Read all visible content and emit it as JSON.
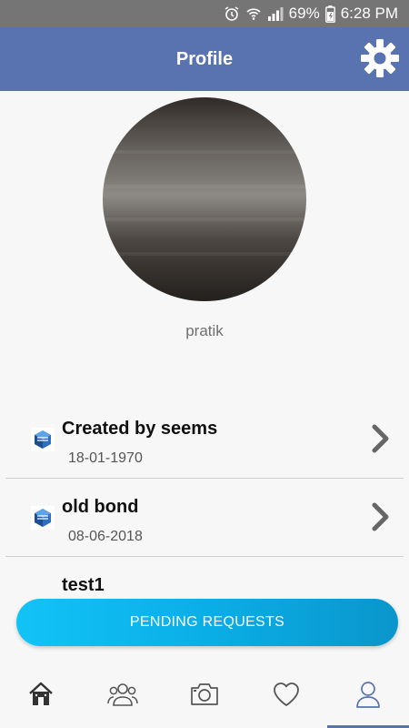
{
  "status_bar": {
    "battery": "69%",
    "time": "6:28 PM"
  },
  "header": {
    "title": "Profile"
  },
  "profile": {
    "username": "pratik"
  },
  "bonds": [
    {
      "name": "Created by seems",
      "date": "18-01-1970"
    },
    {
      "name": "old bond",
      "date": "08-06-2018"
    },
    {
      "name": "test1",
      "date": ""
    }
  ],
  "actions": {
    "pending_requests": "PENDING REQUESTS"
  },
  "bottom_nav": [
    {
      "icon": "home-icon",
      "active": false
    },
    {
      "icon": "group-icon",
      "active": false
    },
    {
      "icon": "camera-icon",
      "active": false
    },
    {
      "icon": "heart-icon",
      "active": false
    },
    {
      "icon": "user-icon",
      "active": true
    }
  ],
  "colors": {
    "header": "#5873b0",
    "button": "#0aaee6",
    "active_tab": "#5873b0"
  }
}
